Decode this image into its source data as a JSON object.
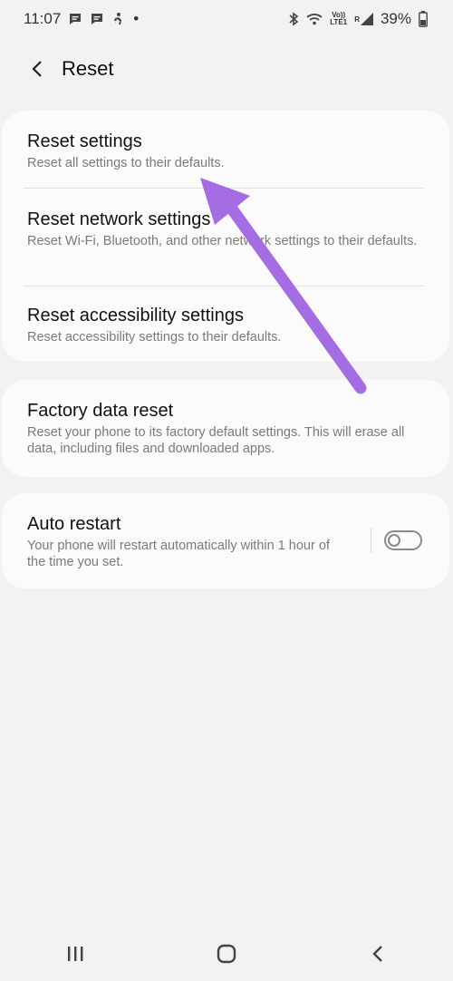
{
  "status_bar": {
    "time": "11:07",
    "dot": "•",
    "volte": "Vo))",
    "lte": "LTE1",
    "roaming": "R",
    "battery": "39%"
  },
  "header": {
    "title": "Reset"
  },
  "items": [
    {
      "title": "Reset settings",
      "subtitle": "Reset all settings to their defaults."
    },
    {
      "title": "Reset network settings",
      "subtitle": "Reset Wi-Fi, Bluetooth, and other network settings to their defaults."
    },
    {
      "title": "Reset accessibility settings",
      "subtitle": "Reset accessibility settings to their defaults."
    },
    {
      "title": "Factory data reset",
      "subtitle": "Reset your phone to its factory default settings. This will erase all data, including files and downloaded apps."
    },
    {
      "title": "Auto restart",
      "subtitle": "Your phone will restart automatically within 1 hour of the time you set."
    }
  ],
  "auto_restart_toggle": {
    "on": false
  },
  "annotation": {
    "arrow_color": "#a46de3"
  }
}
